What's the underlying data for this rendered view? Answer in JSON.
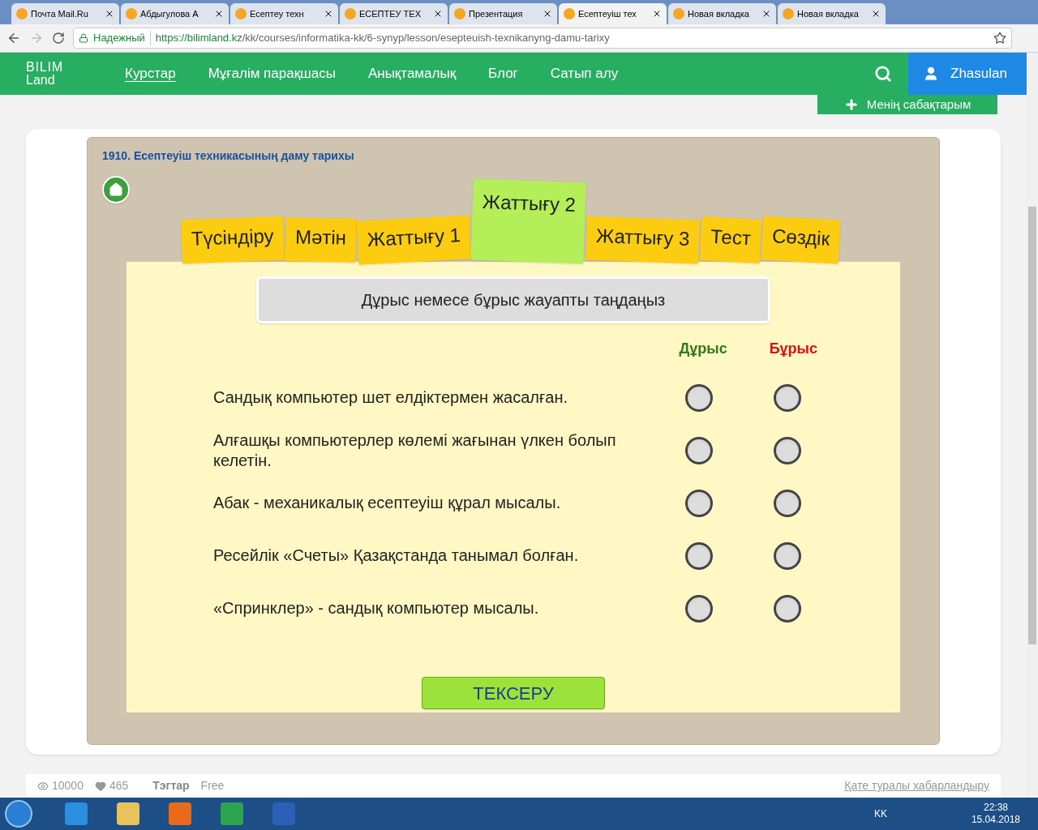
{
  "browser": {
    "tabs": [
      {
        "label": "Почта Mail.Ru",
        "selected": false
      },
      {
        "label": "Абдыгулова А",
        "selected": false
      },
      {
        "label": "Есептеу техн",
        "selected": false
      },
      {
        "label": "ЕСЕПТЕУ ТЕХ",
        "selected": false
      },
      {
        "label": "Презентация",
        "selected": false
      },
      {
        "label": "Есептеуіш тех",
        "selected": true
      },
      {
        "label": "Новая вкладка",
        "selected": false
      },
      {
        "label": "Новая вкладка",
        "selected": false
      }
    ],
    "secure_label": "Надежный",
    "url_host": "https://bilimland.kz",
    "url_path": "/kk/courses/informatika-kk/6-synyp/lesson/esepteuish-texnikanyng-damu-tarixy"
  },
  "header": {
    "logo_top": "BILIM",
    "logo_bottom": "Land",
    "nav": [
      {
        "label": "Курстар",
        "selected": true
      },
      {
        "label": "Мұғалім парақшасы",
        "selected": false
      },
      {
        "label": "Анықтамалық",
        "selected": false
      },
      {
        "label": "Блог",
        "selected": false
      },
      {
        "label": "Сатып алу",
        "selected": false
      }
    ],
    "user": "Zhasulan",
    "my_lessons": "Менің сабақтарым"
  },
  "lesson": {
    "title": "1910. Есептеуіш техникасының даму тарихы",
    "tabs": [
      {
        "label": "Түсіндіру",
        "selected": false
      },
      {
        "label": "Мәтін",
        "selected": false
      },
      {
        "label": "Жаттығу 1",
        "selected": false
      },
      {
        "label": "Жаттығу 2",
        "selected": true
      },
      {
        "label": "Жаттығу 3",
        "selected": false
      },
      {
        "label": "Тест",
        "selected": false
      },
      {
        "label": "Сөздік",
        "selected": false
      }
    ],
    "instruction": "Дұрыс немесе бұрыс жауапты таңдаңыз",
    "true_label": "Дұрыс",
    "false_label": "Бұрыс",
    "questions": [
      {
        "text": "Сандық компьютер шет елдіктермен жасалған.",
        "true_checked": false,
        "false_checked": false
      },
      {
        "text": "Алғашқы компьютерлер көлемі жағынан үлкен болып келетін.",
        "true_checked": false,
        "false_checked": false
      },
      {
        "text": "Абак - механикалық есептеуіш құрал мысалы.",
        "true_checked": false,
        "false_checked": false
      },
      {
        "text": "Ресейлік «Счеты» Қазақстанда танымал болған.",
        "true_checked": false,
        "false_checked": false
      },
      {
        "text": "«Спринклер» - сандық компьютер мысалы.",
        "true_checked": false,
        "false_checked": false
      }
    ],
    "check_button": "ТЕКСЕРУ"
  },
  "footer": {
    "views": "10000",
    "likes": "465",
    "tags_label": "Тэгтар",
    "tags_value": "Free",
    "report_link": "Қате туралы хабарландыру"
  },
  "taskbar": {
    "language": "KK",
    "time": "22:38",
    "date": "15.04.2018"
  }
}
